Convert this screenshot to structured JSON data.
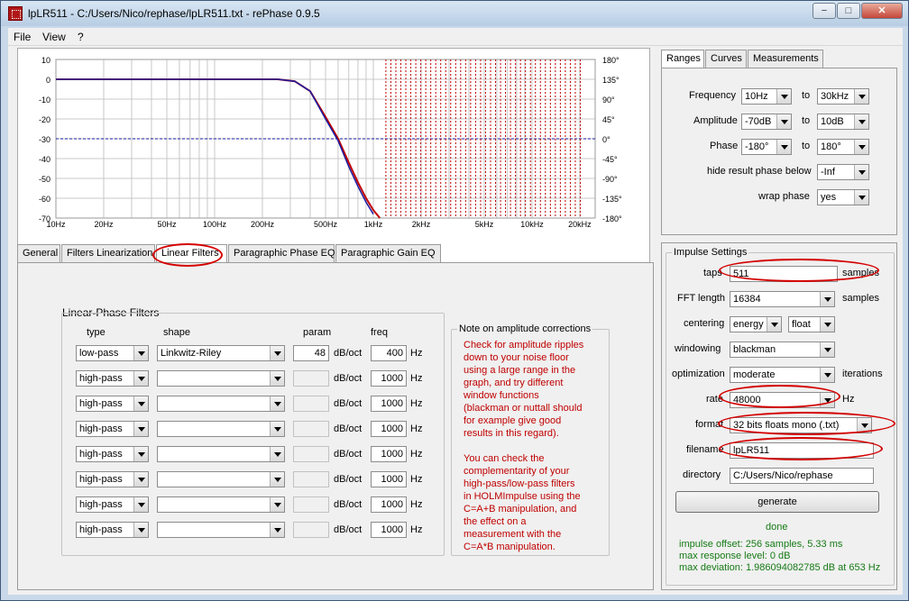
{
  "window": {
    "title": "lpLR511  -  C:/Users/Nico/rephase/lpLR511.txt  -  rePhase 0.9.5",
    "controls": [
      "−",
      "□",
      "✕"
    ]
  },
  "menu": [
    "File",
    "View",
    "?"
  ],
  "graph": {
    "y_left_ticks": [
      "10",
      "0",
      "-10",
      "-20",
      "-30",
      "-40",
      "-50",
      "-60",
      "-70"
    ],
    "y_right_ticks": [
      "180°",
      "135°",
      "90°",
      "45°",
      "0°",
      "-45°",
      "-90°",
      "-135°",
      "-180°"
    ],
    "x_ticks": [
      "10Hz",
      "20Hz",
      "50Hz",
      "100Hz",
      "200Hz",
      "500Hz",
      "1kHz",
      "2kHz",
      "5kHz",
      "10kHz",
      "20kHz"
    ],
    "colors": {
      "magnitude": "#c00000",
      "phase": "#1a1aa0",
      "grid": "#c8c8c8"
    }
  },
  "chart_data": {
    "type": "line",
    "x_scale": "log",
    "xlim": [
      10,
      25000
    ],
    "ylim": [
      -70,
      10
    ],
    "y2lim": [
      -180,
      180
    ],
    "series": [
      {
        "x": [
          10,
          100,
          250,
          320,
          400,
          500,
          600,
          700,
          800,
          900,
          1000,
          1100
        ],
        "values": [
          0,
          0,
          0,
          -1,
          -6,
          -19,
          -30,
          -42,
          -52,
          -60,
          -66,
          -70
        ]
      },
      {
        "x": [
          10,
          100,
          250,
          320,
          400,
          500,
          600,
          700,
          800,
          900,
          1000
        ],
        "values": [
          0,
          0,
          0,
          -1,
          -6,
          -20,
          -31,
          -44,
          -54,
          -62,
          -68
        ]
      }
    ],
    "grid": true
  },
  "main_tabs": [
    "General",
    "Filters Linearization",
    "Linear Filters",
    "Paragraphic Phase EQ",
    "Paragraphic Gain EQ"
  ],
  "linear_phase": {
    "title": "Linear-Phase Filters",
    "headers": {
      "type": "type",
      "shape": "shape",
      "param": "param",
      "freq": "freq"
    },
    "unit_param": "dB/oct",
    "unit_freq": "Hz",
    "rows": [
      {
        "type": "low-pass",
        "shape": "Linkwitz-Riley",
        "param": "48",
        "freq": "400"
      },
      {
        "type": "high-pass",
        "shape": "",
        "param": "",
        "freq": "1000"
      },
      {
        "type": "high-pass",
        "shape": "",
        "param": "",
        "freq": "1000"
      },
      {
        "type": "high-pass",
        "shape": "",
        "param": "",
        "freq": "1000"
      },
      {
        "type": "high-pass",
        "shape": "",
        "param": "",
        "freq": "1000"
      },
      {
        "type": "high-pass",
        "shape": "",
        "param": "",
        "freq": "1000"
      },
      {
        "type": "high-pass",
        "shape": "",
        "param": "",
        "freq": "1000"
      },
      {
        "type": "high-pass",
        "shape": "",
        "param": "",
        "freq": "1000"
      }
    ]
  },
  "note": {
    "title": "Note on amplitude corrections",
    "lines1": [
      "Check for amplitude ripples",
      "down to your noise floor",
      "using a large range in the",
      "graph, and try different",
      "window functions",
      "(blackman or nuttall should",
      "for example give good",
      "results in this regard)."
    ],
    "lines2": [
      "You can check the",
      "complementarity of your",
      "high-pass/low-pass filters",
      "in HOLMImpulse using the",
      "C=A+B manipulation, and",
      "the effect on a",
      "measurement with the",
      "C=A*B manipulation."
    ]
  },
  "right_tabs": [
    "Ranges",
    "Curves",
    "Measurements"
  ],
  "ranges": {
    "to": "to",
    "frequency": {
      "label": "Frequency",
      "from": "10Hz",
      "to": "30kHz"
    },
    "amplitude": {
      "label": "Amplitude",
      "from": "-70dB",
      "to": "10dB"
    },
    "phase": {
      "label": "Phase",
      "from": "-180°",
      "to": "180°"
    },
    "hide_phase": {
      "label": "hide result phase below",
      "value": "-Inf"
    },
    "wrap_phase": {
      "label": "wrap phase",
      "value": "yes"
    }
  },
  "impulse": {
    "title": "Impulse Settings",
    "taps": {
      "label": "taps",
      "value": "511",
      "unit": "samples"
    },
    "fft": {
      "label": "FFT length",
      "value": "16384",
      "unit": "samples"
    },
    "centering": {
      "label": "centering",
      "value": "energy",
      "value2": "float"
    },
    "windowing": {
      "label": "windowing",
      "value": "blackman"
    },
    "optimization": {
      "label": "optimization",
      "value": "moderate",
      "unit": "iterations"
    },
    "rate": {
      "label": "rate",
      "value": "48000",
      "unit": "Hz"
    },
    "format": {
      "label": "format",
      "value": "32 bits floats mono (.txt)"
    },
    "filename": {
      "label": "filename",
      "value": "lpLR511"
    },
    "directory": {
      "label": "directory",
      "value": "C:/Users/Nico/rephase"
    },
    "generate": "generate",
    "status": "done",
    "info": [
      "impulse offset: 256 samples, 5.33 ms",
      "max response level: 0 dB",
      "max deviation: 1.986094082785 dB at 653 Hz"
    ]
  }
}
